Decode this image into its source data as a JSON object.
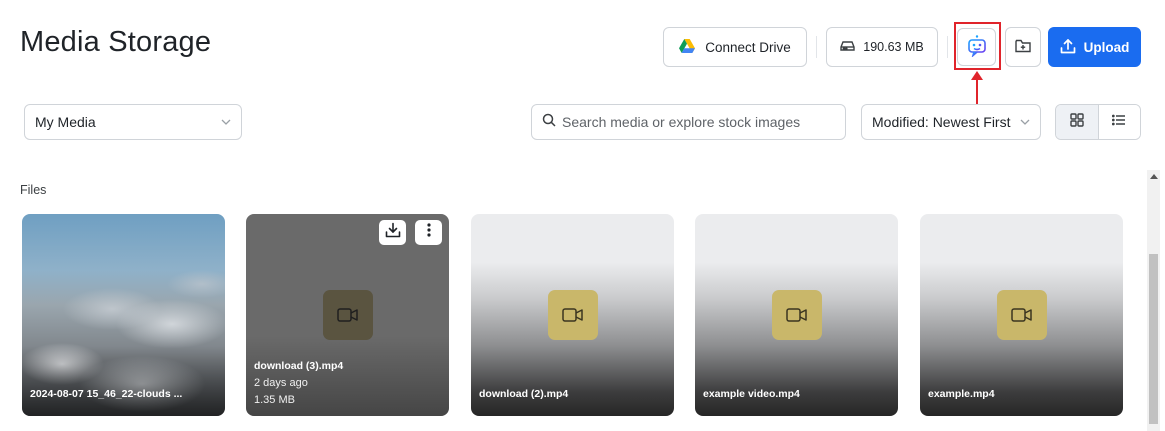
{
  "header": {
    "title": "Media Storage",
    "connect_drive_label": "Connect Drive",
    "storage_used": "190.63 MB",
    "upload_label": "Upload"
  },
  "toolbar": {
    "media_filter": "My Media",
    "search_placeholder": "Search media or explore stock images",
    "sort_value": "Modified: Newest First",
    "view_mode": "grid"
  },
  "section": {
    "files_label": "Files"
  },
  "files": [
    {
      "name": "2024-08-07 15_46_22-clouds ...",
      "type": "image"
    },
    {
      "name": "download (3).mp4",
      "type": "video",
      "age": "2 days ago",
      "size": "1.35 MB"
    },
    {
      "name": "download (2).mp4",
      "type": "video"
    },
    {
      "name": "example video.mp4",
      "type": "video"
    },
    {
      "name": "example.mp4",
      "type": "video"
    }
  ],
  "icons": {
    "drive": "google-drive-icon",
    "storage": "hard-drive-icon",
    "ai": "ai-robot-icon",
    "new_folder": "folder-plus-icon",
    "upload": "upload-icon",
    "search": "search-icon",
    "grid": "grid-view-icon",
    "list": "list-view-icon",
    "video": "video-camera-icon",
    "download": "download-icon",
    "more": "more-vertical-icon"
  },
  "colors": {
    "primary": "#1a6cf0",
    "annotation": "#e0242b",
    "video_tile": "#c9b76a"
  }
}
